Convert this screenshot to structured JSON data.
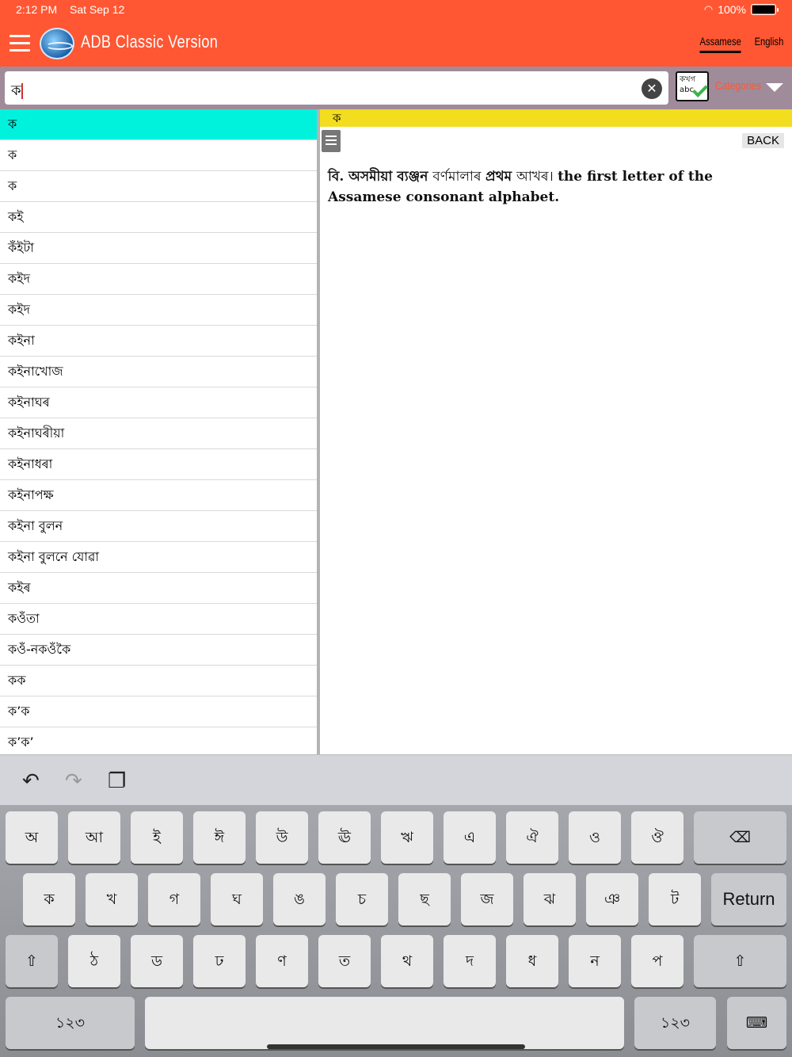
{
  "status": {
    "time": "2:12 PM",
    "date": "Sat Sep 12",
    "battery": "100%"
  },
  "header": {
    "title": "ADB Classic Version",
    "tabs": [
      "Assamese",
      "English"
    ],
    "active_tab": "Assamese"
  },
  "search": {
    "value": "ক",
    "categories_label": "Categories",
    "cat_icon_top": "কখগ",
    "cat_icon_bottom": "abc"
  },
  "word_list": [
    "ক",
    "ক",
    "ক",
    "কই",
    "কঁইটা",
    "কইদ",
    "কইদ",
    "কইনা",
    "কইনাখোজ",
    "কইনাঘৰ",
    "কইনাঘৰীয়া",
    "কইনাধৰা",
    "কইনাপক্ষ",
    "কইনা বুলন",
    "কইনা বুলনে যোৱা",
    "কইৰ",
    "কওঁতা",
    "কওঁ-নকওঁকৈ",
    "কক",
    "ক’ক",
    "ক’ক’"
  ],
  "detail": {
    "headword": "ক",
    "back_label": "BACK",
    "def_part1": "বি. অসমীয়া ব্যঞ্জন ",
    "def_part2": "বৰ্ণমালাৰ ",
    "def_part3": "প্ৰথম ",
    "def_part4": "আখৰ। ",
    "def_part5": "the first letter of the Assamese consonant alphabet."
  },
  "keyboard": {
    "row1": [
      "অ",
      "আ",
      "ই",
      "ঈ",
      "উ",
      "ঊ",
      "ঋ",
      "এ",
      "ঐ",
      "ও",
      "ঔ"
    ],
    "row2": [
      "ক",
      "খ",
      "গ",
      "ঘ",
      "ঙ",
      "চ",
      "ছ",
      "জ",
      "ঝ",
      "ঞ",
      "ট"
    ],
    "row3": [
      "ঠ",
      "ড",
      "ঢ",
      "ণ",
      "ত",
      "থ",
      "দ",
      "ধ",
      "ন",
      "প"
    ],
    "return_label": "Return",
    "num_label": "১২৩"
  },
  "colors": {
    "header": "#ff5733",
    "selected_row": "#00f2dc",
    "headword_bar": "#f2dd1e"
  }
}
